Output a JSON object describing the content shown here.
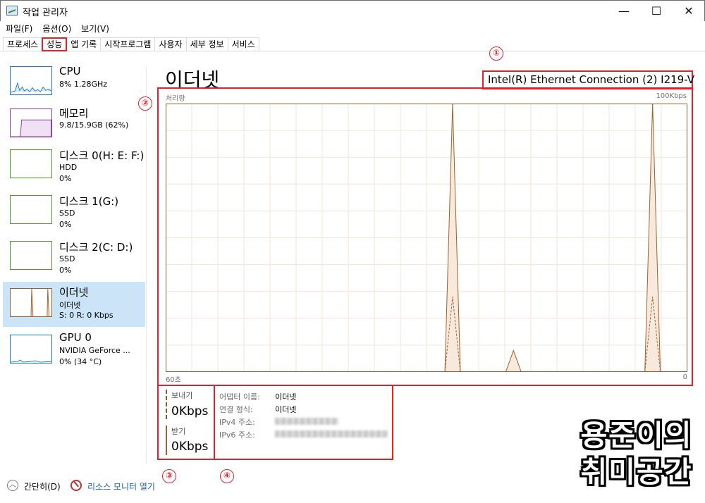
{
  "window": {
    "title": "작업 관리자",
    "icons": {
      "app": "task-manager-icon",
      "minimize": "minimize-icon",
      "maximize": "maximize-icon",
      "close": "close-icon"
    },
    "controls": {
      "minimize": "—",
      "maximize": "☐",
      "close": "✕"
    }
  },
  "menu": [
    "파일(F)",
    "옵션(O)",
    "보기(V)"
  ],
  "tabs": [
    {
      "label": "프로세스",
      "active": false
    },
    {
      "label": "성능",
      "active": true
    },
    {
      "label": "앱 기록",
      "active": false
    },
    {
      "label": "시작프로그램",
      "active": false
    },
    {
      "label": "사용자",
      "active": false
    },
    {
      "label": "세부 정보",
      "active": false
    },
    {
      "label": "서비스",
      "active": false
    }
  ],
  "sidebar": [
    {
      "name": "CPU",
      "line1": "8% 1.28GHz",
      "line2": "",
      "color": "#1f7ab8"
    },
    {
      "name": "메모리",
      "line1": "9.8/15.9GB (62%)",
      "line2": "",
      "color": "#8b3fa0"
    },
    {
      "name": "디스크 0(H: E: F:)",
      "line1": "HDD",
      "line2": "0%",
      "color": "#4ca028"
    },
    {
      "name": "디스크 1(G:)",
      "line1": "SSD",
      "line2": "0%",
      "color": "#4ca028"
    },
    {
      "name": "디스크 2(C: D:)",
      "line1": "SSD",
      "line2": "0%",
      "color": "#4ca028"
    },
    {
      "name": "이더넷",
      "line1": "이더넷",
      "line2": "S: 0 R: 0 Kbps",
      "color": "#a0602a",
      "active": true
    },
    {
      "name": "GPU 0",
      "line1": "NVIDIA GeForce ...",
      "line2": "0% (34 °C)",
      "color": "#1f7ab8"
    }
  ],
  "main": {
    "title": "이더넷",
    "adapter_name": "Intel(R) Ethernet Connection (2) I219-V",
    "graph": {
      "label": "처리량",
      "max_label": "100Kbps",
      "x_start_label": "60초",
      "x_end_label": "0",
      "color": "#a0602a",
      "send_peaks_pct": [
        0,
        0,
        0,
        0,
        0,
        0,
        0,
        0,
        0,
        0,
        0,
        0,
        0,
        0,
        0,
        0,
        0,
        0,
        0,
        0,
        0,
        0,
        0,
        0,
        0,
        0,
        0,
        0,
        0,
        0,
        0,
        0,
        0,
        0,
        0,
        0,
        0,
        0,
        0,
        0,
        0,
        0,
        0,
        0,
        0,
        0,
        0,
        0,
        0,
        0,
        0,
        0,
        0,
        0,
        0,
        0,
        0,
        0,
        0,
        0,
        0
      ],
      "receive_pct": [
        0,
        0,
        0,
        0,
        0,
        0,
        0,
        0,
        0,
        0,
        0,
        0,
        0,
        0,
        0,
        0,
        0,
        0,
        0,
        0,
        0,
        0,
        0,
        0,
        0,
        0,
        0,
        0,
        0,
        0,
        0,
        0,
        0,
        0,
        0,
        0,
        0,
        0,
        0,
        0,
        0,
        0,
        0,
        0,
        0,
        0,
        0,
        0,
        0,
        0,
        0,
        0,
        0,
        0,
        0,
        0,
        0,
        0,
        0,
        0,
        0
      ],
      "events": [
        {
          "second_ago": 20,
          "receive_pct": 8,
          "send_pct": 0
        },
        {
          "second_ago": 27,
          "receive_pct": 100,
          "send_pct": 7
        },
        {
          "second_ago": 4,
          "receive_pct": 100,
          "send_pct": 7
        }
      ]
    },
    "send": {
      "label": "보내기",
      "value": "0Kbps"
    },
    "receive": {
      "label": "받기",
      "value": "0Kbps"
    },
    "info": [
      {
        "key": "어댑터 이름:",
        "value": "이더넷"
      },
      {
        "key": "연결 형식:",
        "value": "이더넷"
      },
      {
        "key": "IPv4 주소:",
        "value": ""
      },
      {
        "key": "IPv6 주소:",
        "value": ""
      }
    ]
  },
  "markers": [
    "①",
    "②",
    "③",
    "④"
  ],
  "footer": {
    "collapse": "간단히(D)",
    "resource_monitor": "리소스 모니터 열기"
  },
  "watermark": [
    "용준이의",
    "취미공간"
  ],
  "colors": {
    "highlight": "#e0202a",
    "selected": "#cce4f7",
    "ethernet": "#a0602a",
    "link": "#1a5fb4"
  }
}
